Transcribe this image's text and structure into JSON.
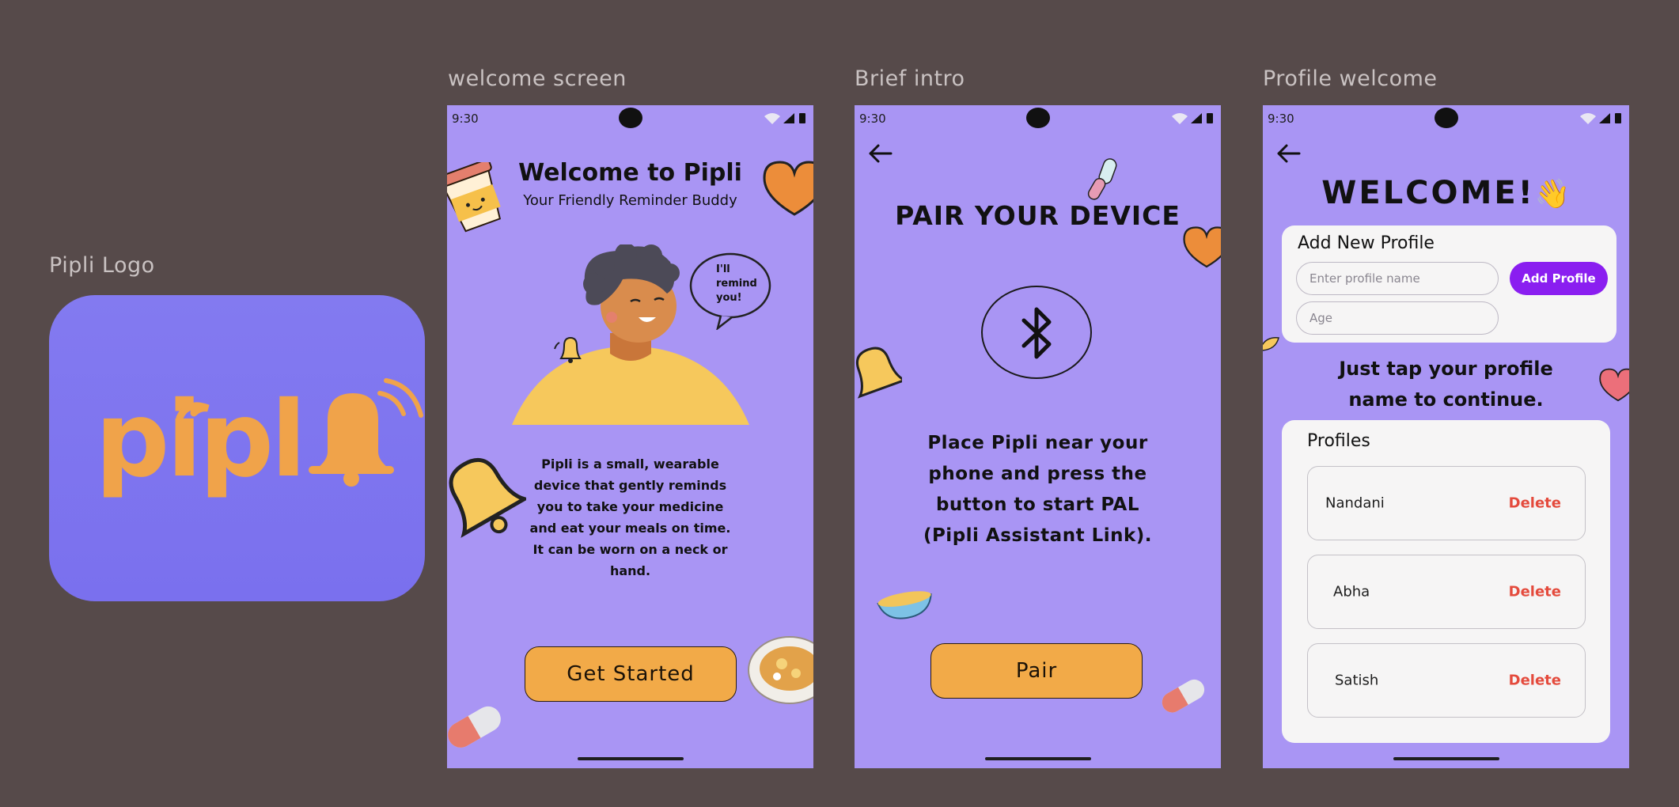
{
  "labels": {
    "logo": "Pipli Logo",
    "welcome": "welcome screen",
    "intro": "Brief intro",
    "profile": "Profile welcome"
  },
  "logo": {
    "wordmark": "pipl"
  },
  "colors": {
    "background": "#564a4a",
    "phone_bg": "#a995f4",
    "logo_bg": "#7d74ef",
    "accent_orange": "#f2aa48",
    "primary_purple": "#8a1ef0",
    "delete_red": "#e44a3c"
  },
  "status_time": "9:30",
  "welcome": {
    "title": "Welcome to Pipli",
    "subtitle": "Your Friendly Reminder Buddy",
    "speech": [
      "I'll",
      "remind",
      "you!"
    ],
    "description": [
      "Pipli is a small, wearable",
      "device that gently reminds",
      "you to take your medicine",
      "and eat your meals on time.",
      "It can be worn on a neck or",
      "hand."
    ],
    "button": "Get Started"
  },
  "intro": {
    "title": "PAIR YOUR DEVICE",
    "icon": "bluetooth-icon",
    "description": [
      "Place Pipli near your",
      "phone and press the",
      "button to start PAL",
      "(Pipli Assistant Link)."
    ],
    "button": "Pair"
  },
  "profile": {
    "title": "WELCOME!",
    "title_emoji": "👋",
    "add_card_title": "Add New Profile",
    "name_placeholder": "Enter profile name",
    "age_placeholder": "Age",
    "add_button": "Add Profile",
    "instruction": [
      "Just tap your profile",
      "name to continue."
    ],
    "profiles_title": "Profiles",
    "profiles": [
      {
        "name": "Nandani",
        "action": "Delete"
      },
      {
        "name": "Abha",
        "action": "Delete"
      },
      {
        "name": "Satish",
        "action": "Delete"
      }
    ]
  }
}
